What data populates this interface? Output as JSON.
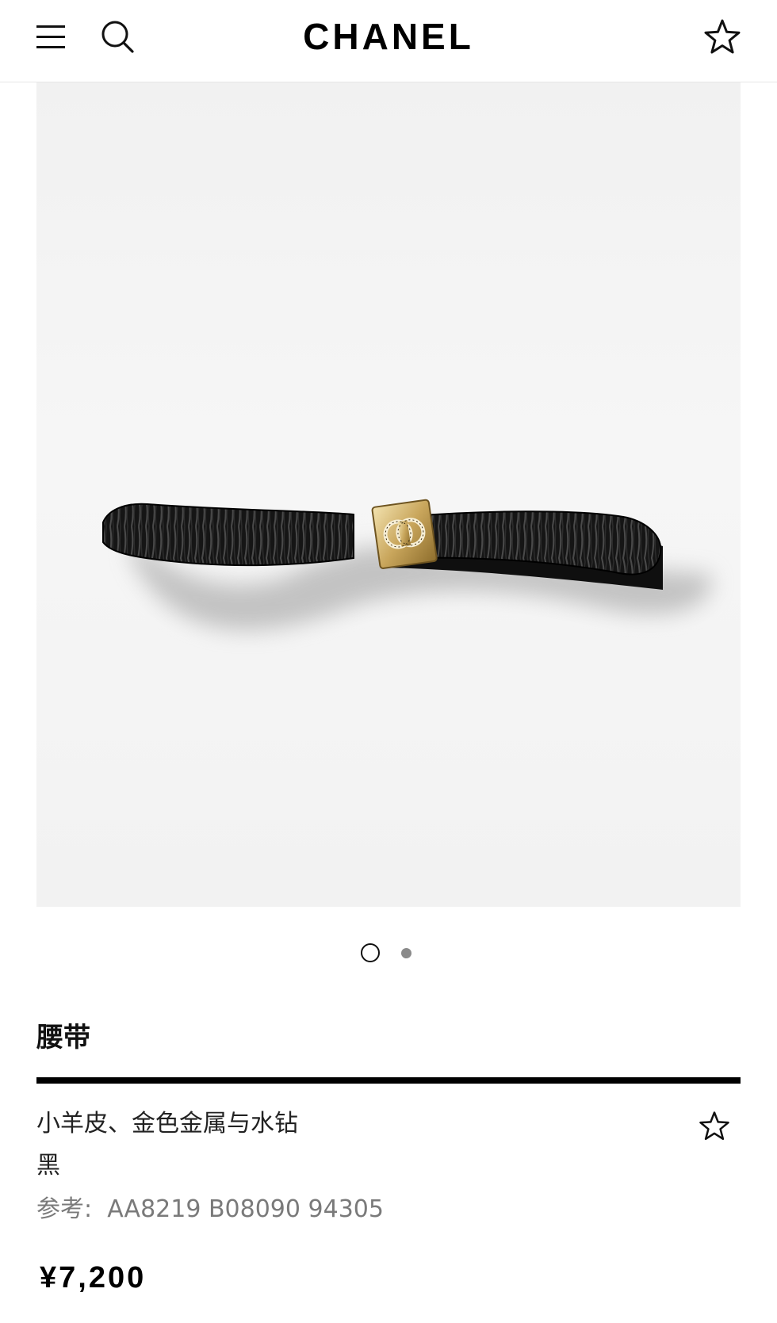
{
  "header": {
    "brand": "CHANEL",
    "icons": {
      "menu": "hamburger-menu-icon",
      "search": "search-icon",
      "favorite": "star-outline-icon"
    }
  },
  "gallery": {
    "image_subject": "black-gathered-leather-belt-with-gold-cc-buckle",
    "image_count": 2,
    "current_index": 1
  },
  "product": {
    "name": "腰带",
    "material": "小羊皮、金色金属与水钻",
    "color": "黑",
    "reference_label": "参考:",
    "reference_code": "AA8219 B08090 94305",
    "price": "¥7,200"
  },
  "colors": {
    "text": "#111111",
    "muted": "#7a7a7a",
    "rule": "#000000",
    "dot_inactive": "#8a8a8a"
  }
}
